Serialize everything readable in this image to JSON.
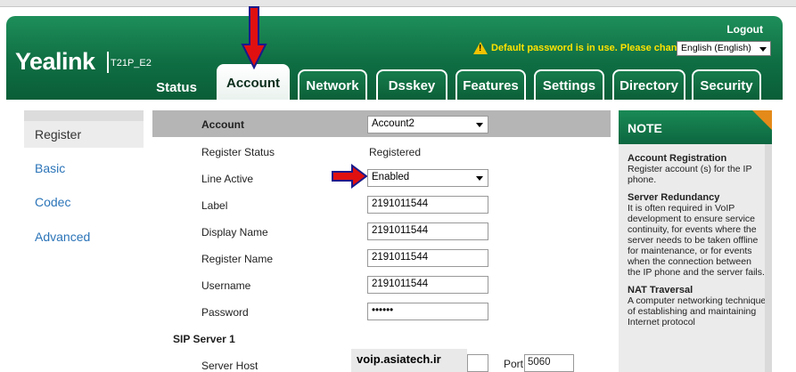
{
  "header": {
    "brand": "Yealink",
    "model": "T21P_E2",
    "logout": "Logout",
    "warning": "Default password is in use. Please change!",
    "language": "English (English)"
  },
  "tabs": [
    {
      "label": "Status"
    },
    {
      "label": "Account"
    },
    {
      "label": "Network"
    },
    {
      "label": "Dsskey"
    },
    {
      "label": "Features"
    },
    {
      "label": "Settings"
    },
    {
      "label": "Directory"
    },
    {
      "label": "Security"
    }
  ],
  "sidebar": {
    "items": [
      {
        "label": "Register"
      },
      {
        "label": "Basic"
      },
      {
        "label": "Codec"
      },
      {
        "label": "Advanced"
      }
    ]
  },
  "form": {
    "account_label": "Account",
    "account_value": "Account2",
    "register_status_label": "Register Status",
    "register_status_value": "Registered",
    "line_active_label": "Line Active",
    "line_active_value": "Enabled",
    "label_label": "Label",
    "label_value": "2191011544",
    "display_name_label": "Display Name",
    "display_name_value": "2191011544",
    "register_name_label": "Register Name",
    "register_name_value": "2191011544",
    "username_label": "Username",
    "username_value": "2191011544",
    "password_label": "Password",
    "password_value": "••••••",
    "sip_server_heading": "SIP Server 1",
    "server_host_label": "Server Host",
    "server_host_value": "voip.asiatech.ir",
    "port_label": "Port",
    "port_value": "5060"
  },
  "note": {
    "heading": "NOTE",
    "sections": [
      {
        "title": "Account Registration",
        "text": "Register account (s) for the IP phone."
      },
      {
        "title": "Server Redundancy",
        "text": "It is often required in VoIP development to ensure service continuity, for events where the server needs to be taken offline for maintenance, or for events when the connection between the IP phone and the server fails."
      },
      {
        "title": "NAT Traversal",
        "text": "A computer networking technique of establishing and maintaining Internet protocol"
      }
    ]
  },
  "colors": {
    "header_green": "#0f6e43",
    "warning_yellow": "#ffe300",
    "annotation_red": "#e01010",
    "sidebar_link": "#2b74b8",
    "note_corner": "#e48a1a"
  }
}
